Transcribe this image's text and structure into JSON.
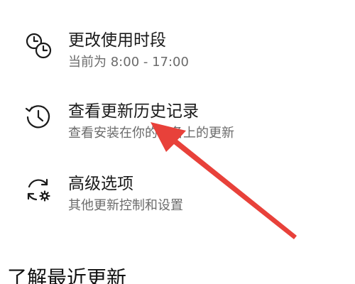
{
  "options": [
    {
      "icon": "clock-schedule-icon",
      "title": "更改使用时段",
      "subtitle": "当前为 8:00 - 17:00"
    },
    {
      "icon": "history-clock-icon",
      "title": "查看更新历史记录",
      "subtitle": "查看安装在你的设备上的更新"
    },
    {
      "icon": "sync-gear-icon",
      "title": "高级选项",
      "subtitle": "其他更新控制和设置"
    }
  ],
  "section": {
    "title": "了解最近更新"
  },
  "colors": {
    "text": "#1a1a1a",
    "secondary_text": "#6b6b6b",
    "annotation_arrow": "#e8413a"
  }
}
